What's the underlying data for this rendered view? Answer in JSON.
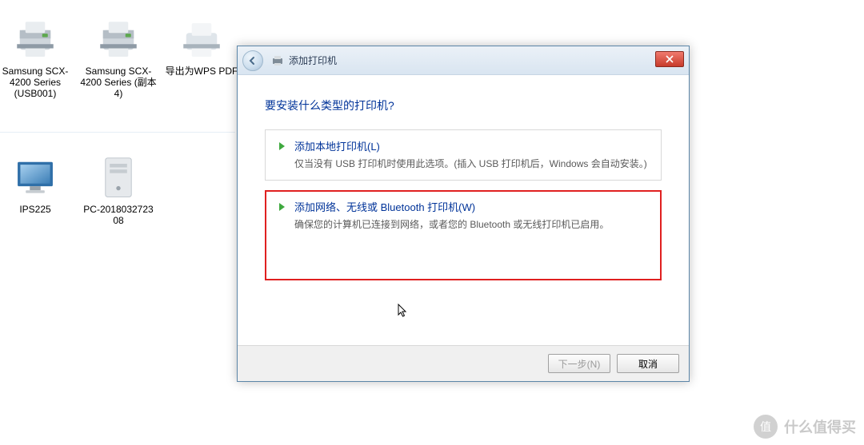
{
  "desktop": {
    "items": [
      {
        "label": "Samsung SCX-4200 Series (USB001)",
        "kind": "printer"
      },
      {
        "label": "Samsung SCX-4200 Series (副本 4)",
        "kind": "printer"
      },
      {
        "label": "导出为WPS PDF",
        "kind": "pdf-printer"
      },
      {
        "label": "IPS225",
        "kind": "monitor"
      },
      {
        "label": "PC-2018032723 08",
        "kind": "pc"
      }
    ]
  },
  "dialog": {
    "title": "添加打印机",
    "heading": "要安装什么类型的打印机?",
    "options": [
      {
        "title": "添加本地打印机(L)",
        "desc": "仅当没有 USB 打印机时使用此选项。(插入 USB 打印机后，Windows 会自动安装。)",
        "highlighted": false
      },
      {
        "title": "添加网络、无线或 Bluetooth 打印机(W)",
        "desc": "确保您的计算机已连接到网络，或者您的 Bluetooth 或无线打印机已启用。",
        "highlighted": true
      }
    ],
    "buttons": {
      "next": "下一步(N)",
      "cancel": "取消"
    }
  },
  "watermark": {
    "badge": "值",
    "text": "什么值得买"
  }
}
